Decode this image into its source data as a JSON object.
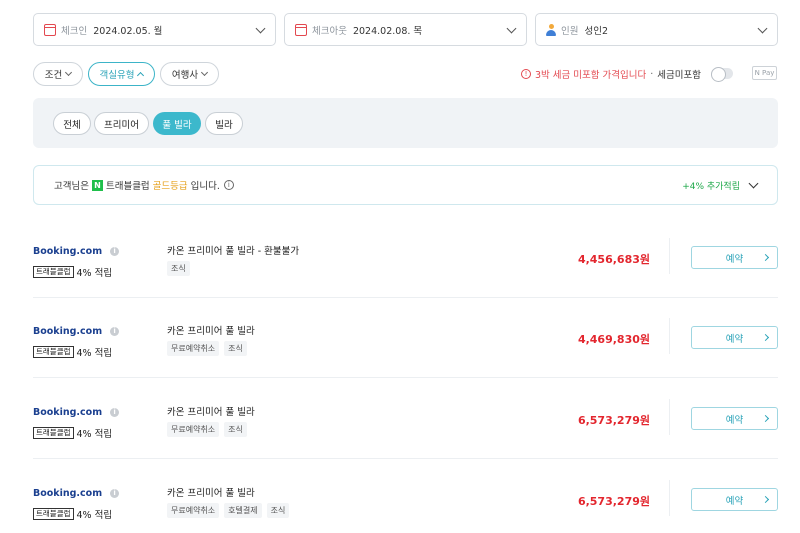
{
  "search": {
    "checkin": {
      "label": "체크인",
      "value": "2024.02.05. 월"
    },
    "checkout": {
      "label": "체크아웃",
      "value": "2024.02.08. 목"
    },
    "guests": {
      "label": "인원",
      "value": "성인2"
    }
  },
  "filters": {
    "conditions": "조건",
    "room_type": "객실유형",
    "agency": "여행사",
    "warning": "3박 세금 미포함 가격입니다",
    "separator": "·",
    "tax_toggle_label": "세금미포함",
    "tax_toggle_on": false,
    "npay_label": "N Pay"
  },
  "room_type_chips": [
    {
      "label": "전체",
      "selected": false
    },
    {
      "label": "프리미어",
      "selected": false
    },
    {
      "label": "풀 빌라",
      "selected": true
    },
    {
      "label": "빌라",
      "selected": false
    }
  ],
  "club_banner": {
    "prefix": "고객님은",
    "n_mark": "N",
    "club_name": "트래블클럽",
    "grade": "골드등급",
    "suffix": "입니다.",
    "reward": "+4% 추가적립"
  },
  "offers": [
    {
      "brand": "Booking.com",
      "club_tag": "트래블클럽",
      "reward": "4% 적립",
      "room": "카온 프리미어 풀 빌라 - 환불불가",
      "tags": [
        "조식"
      ],
      "price": "4,456,683원",
      "action": "예약"
    },
    {
      "brand": "Booking.com",
      "club_tag": "트래블클럽",
      "reward": "4% 적립",
      "room": "카온 프리미어 풀 빌라",
      "tags": [
        "무료예약취소",
        "조식"
      ],
      "price": "4,469,830원",
      "action": "예약"
    },
    {
      "brand": "Booking.com",
      "club_tag": "트래블클럽",
      "reward": "4% 적립",
      "room": "카온 프리미어 풀 빌라",
      "tags": [
        "무료예약취소",
        "조식"
      ],
      "price": "6,573,279원",
      "action": "예약"
    },
    {
      "brand": "Booking.com",
      "club_tag": "트래블클럽",
      "reward": "4% 적립",
      "room": "카온 프리미어 풀 빌라",
      "tags": [
        "무료예약취소",
        "호텔결제",
        "조식"
      ],
      "price": "6,573,279원",
      "action": "예약"
    }
  ],
  "colors": {
    "accent": "#3cb8cc",
    "price": "#e3262e",
    "reward": "#1fa84a",
    "gold": "#e6a11c",
    "warning": "#e3484f"
  }
}
